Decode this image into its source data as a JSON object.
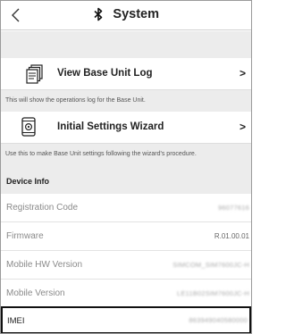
{
  "header": {
    "title": "System",
    "back_icon": "chevron-left-icon",
    "title_icon": "bluetooth-icon"
  },
  "menu": [
    {
      "label": "View Base Unit Log",
      "icon": "document-stack-icon",
      "chevron": ">",
      "description": "This will show the operations log for the Base Unit."
    },
    {
      "label": "Initial Settings Wizard",
      "icon": "phone-settings-icon",
      "chevron": ">",
      "description": "Use this to make Base Unit settings following the wizard's procedure."
    }
  ],
  "device_info": {
    "heading": "Device Info",
    "rows": [
      {
        "label": "Registration Code",
        "value": "96077616"
      },
      {
        "label": "Firmware",
        "value": "R.01.00.01"
      },
      {
        "label": "Mobile HW Version",
        "value": "SIMCOM_SIM7600JC-H"
      },
      {
        "label": "Mobile Version",
        "value": "LE11B02SIM7600JC-H"
      },
      {
        "label": "IMEI",
        "value": "863949040580000"
      }
    ]
  }
}
